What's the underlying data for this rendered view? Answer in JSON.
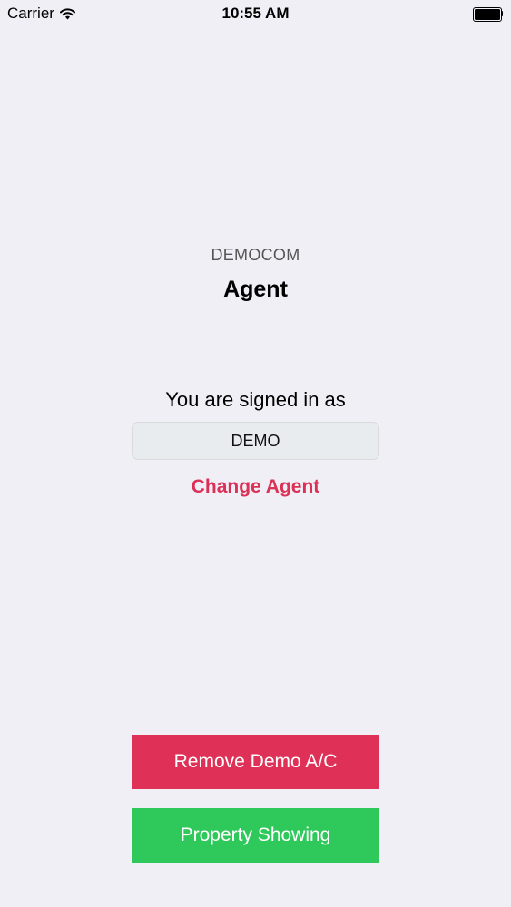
{
  "status_bar": {
    "carrier": "Carrier",
    "time": "10:55 AM",
    "battery_level": 1.0
  },
  "header": {
    "company": "DEMOCOM",
    "title": "Agent"
  },
  "signin": {
    "label": "You are signed in as",
    "agent_name": "DEMO",
    "change_label": "Change Agent"
  },
  "actions": {
    "remove_label": "Remove Demo A/C",
    "showing_label": "Property Showing"
  },
  "colors": {
    "background": "#f0eff5",
    "accent_red": "#df3157",
    "accent_green": "#2fc85a"
  },
  "icons": [
    "wifi-icon",
    "battery-icon"
  ]
}
